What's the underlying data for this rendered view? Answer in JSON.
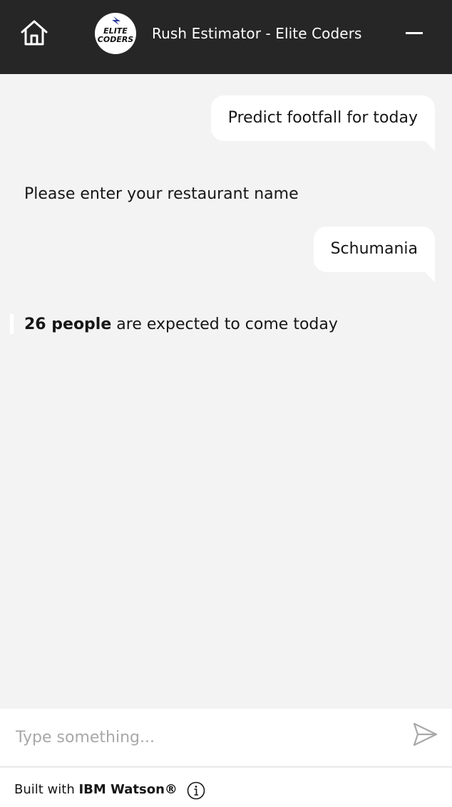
{
  "header": {
    "home_icon": "home-icon",
    "logo_line1": "ELITE",
    "logo_line2": "CODERS",
    "title": "Rush Estimator - Elite Coders",
    "minimize_icon": "minimize-icon"
  },
  "messages": [
    {
      "from": "user",
      "text": "Predict footfall for today"
    },
    {
      "from": "bot",
      "text": "Please enter your restaurant name"
    },
    {
      "from": "user",
      "text": "Schumania"
    },
    {
      "from": "bot",
      "bold": "26 people",
      "text": " are expected to come today"
    }
  ],
  "input": {
    "placeholder": "Type something...",
    "send_icon": "send-icon"
  },
  "footer": {
    "prefix": "Built with ",
    "brand": "IBM Watson®",
    "info_icon": "info-icon"
  },
  "colors": {
    "header_bg": "#262626",
    "chat_bg": "#f3f3f3",
    "bubble_bg": "#ffffff",
    "text": "#161616",
    "placeholder": "#a8a8a8"
  }
}
